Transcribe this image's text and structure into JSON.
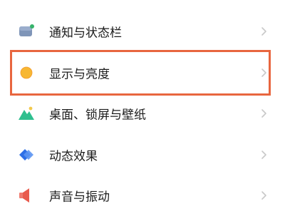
{
  "settings": {
    "items": [
      {
        "label": "通知与状态栏",
        "icon": "notification-bar-icon"
      },
      {
        "label": "显示与亮度",
        "icon": "brightness-icon"
      },
      {
        "label": "桌面、锁屏与壁纸",
        "icon": "wallpaper-icon"
      },
      {
        "label": "动态效果",
        "icon": "dynamic-effects-icon"
      },
      {
        "label": "声音与振动",
        "icon": "sound-icon"
      }
    ],
    "highlighted_index": 1
  },
  "colors": {
    "highlight_border": "#e8663f",
    "chevron": "#c8c8c8",
    "text": "#1c1c1c",
    "notification_icon": "#7f95b8",
    "notification_badge": "#36b36a",
    "brightness_icon": "#f7b733",
    "wallpaper_icon": "#2fbf8f",
    "dynamic_icon": "#2e6fe6",
    "sound_icon": "#e85b4d"
  }
}
